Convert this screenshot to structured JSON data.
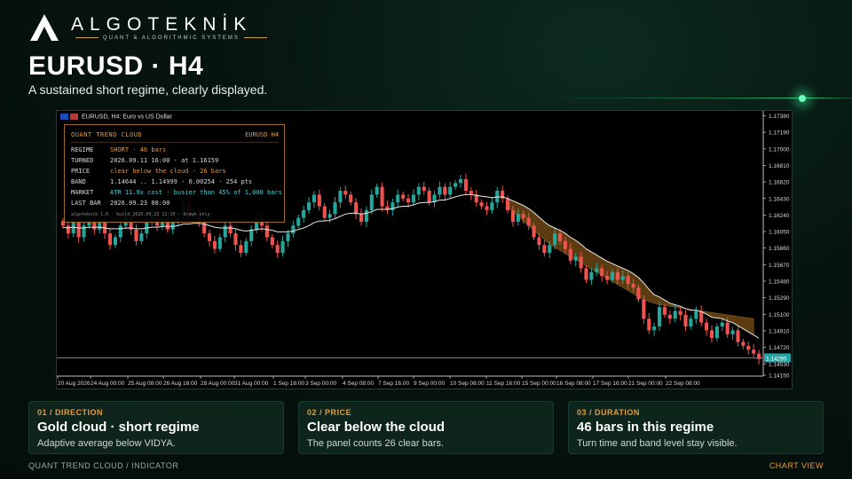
{
  "brand": {
    "name": "ALGOTEKNİK",
    "tagline": "QUANT & ALGORITHMIC SYSTEMS",
    "accent": "#caa24a"
  },
  "header": {
    "title": "EURUSD · H4",
    "subtitle": "A sustained short regime, clearly displayed."
  },
  "chart_window": {
    "title": "EURUSD, H4:  Euro vs US Dollar",
    "icons": [
      "flag-eu-icon",
      "flag-us-icon"
    ]
  },
  "panel": {
    "title": "QUANT TREND CLOUD",
    "symbol": "EURUSD H4",
    "rows": [
      {
        "key": "REGIME",
        "value": "SHORT  · 46 bars",
        "tone": "orange"
      },
      {
        "key": "TURNED",
        "value": "2026.09.11 16:00 · at 1.16159",
        "tone": "normal"
      },
      {
        "key": "PRICE",
        "value": "clear below the cloud · 26 bars",
        "tone": "orange"
      },
      {
        "key": "BAND",
        "value": "1.14644 .. 1.14999 · 0.00254 · 254 pts",
        "tone": "normal"
      },
      {
        "key": "MARKET",
        "value": "ATR 11.9x cost · busier than 45% of 1,000 bars",
        "tone": "cyan"
      },
      {
        "key": "LAST BAR",
        "value": "2026.09.23 08:00",
        "tone": "normal"
      }
    ],
    "footer": "algoteknik 1.0 · build 2026.09.22 12:10 · drawn only"
  },
  "chart_data": {
    "type": "candlestick",
    "symbol": "EURUSD",
    "timeframe": "H4",
    "ylim": [
      1.1406,
      1.1748
    ],
    "y_ticks": [
      "1.17380",
      "1.17190",
      "1.17000",
      "1.16810",
      "1.16620",
      "1.16430",
      "1.16240",
      "1.16050",
      "1.15860",
      "1.15670",
      "1.15480",
      "1.15290",
      "1.15100",
      "1.14910",
      "1.14720",
      "1.14530",
      "1.14150"
    ],
    "x_ticks": [
      "20 Aug 2026",
      "24 Aug 00:00",
      "25 Aug 08:00",
      "26 Aug 16:00",
      "28 Aug 00:00",
      "31 Aug 00:00",
      "1 Sep 16:00",
      "3 Sep 00:00",
      "4 Sep 08:00",
      "7 Sep 16:00",
      "9 Sep 00:00",
      "10 Sep 08:00",
      "11 Sep 16:00",
      "15 Sep 00:00",
      "16 Sep 08:00",
      "17 Sep 16:00",
      "21 Sep 00:00",
      "22 Sep 08:00"
    ],
    "current_price": "1.14295",
    "current_price_value": 1.14295,
    "colors": {
      "bull": "#26a69a",
      "bear": "#ef5350",
      "cloud": "#6b4512",
      "avg": "#e8e8e8",
      "price_line": "#1fa7a7"
    },
    "close": [
      1.16,
      1.159,
      1.161,
      1.1585,
      1.16,
      1.161,
      1.1595,
      1.1605,
      1.159,
      1.1575,
      1.1585,
      1.16,
      1.1615,
      1.1595,
      1.158,
      1.159,
      1.1605,
      1.162,
      1.16,
      1.161,
      1.1595,
      1.1605,
      1.1615,
      1.163,
      1.161,
      1.162,
      1.1605,
      1.159,
      1.158,
      1.157,
      1.1585,
      1.16,
      1.159,
      1.1575,
      1.1565,
      1.158,
      1.1595,
      1.161,
      1.16,
      1.1585,
      1.1575,
      1.1565,
      1.158,
      1.159,
      1.16,
      1.161,
      1.162,
      1.163,
      1.164,
      1.1625,
      1.161,
      1.1615,
      1.163,
      1.1645,
      1.164,
      1.163,
      1.1615,
      1.1605,
      1.162,
      1.164,
      1.165,
      1.1625,
      1.162,
      1.163,
      1.164,
      1.1635,
      1.163,
      1.164,
      1.165,
      1.1645,
      1.163,
      1.164,
      1.165,
      1.164,
      1.165,
      1.1655,
      1.166,
      1.1645,
      1.164,
      1.163,
      1.1625,
      1.162,
      1.163,
      1.1645,
      1.1635,
      1.162,
      1.1605,
      1.1615,
      1.161,
      1.16,
      1.1585,
      1.1575,
      1.1565,
      1.1575,
      1.159,
      1.158,
      1.157,
      1.1555,
      1.156,
      1.1545,
      1.153,
      1.154,
      1.1545,
      1.1535,
      1.153,
      1.154,
      1.153,
      1.1535,
      1.1525,
      1.152,
      1.1505,
      1.148,
      1.1465,
      1.147,
      1.1495,
      1.1485,
      1.148,
      1.149,
      1.1485,
      1.147,
      1.148,
      1.149,
      1.1475,
      1.1465,
      1.1455,
      1.147,
      1.1475,
      1.146,
      1.1465,
      1.145,
      1.1445,
      1.144,
      1.1435,
      1.1428
    ],
    "cloud_upper": [
      null,
      null,
      null,
      null,
      null,
      null,
      null,
      null,
      null,
      null,
      null,
      null,
      null,
      null,
      null,
      null,
      null,
      null,
      null,
      null,
      null,
      null,
      null,
      null,
      null,
      null,
      null,
      null,
      null,
      null,
      null,
      null,
      null,
      null,
      null,
      null,
      null,
      null,
      null,
      null,
      null,
      null,
      null,
      null,
      null,
      null,
      null,
      null,
      null,
      null,
      null,
      null,
      null,
      null,
      null,
      null,
      null,
      null,
      null,
      null,
      null,
      null,
      null,
      null,
      null,
      null,
      null,
      null,
      null,
      null,
      null,
      null,
      null,
      null,
      null,
      null,
      null,
      null,
      null,
      null,
      null,
      null,
      null,
      null,
      null,
      1.1624,
      1.1618,
      1.1612,
      1.1606,
      1.16,
      1.1594,
      1.1588,
      1.1582,
      1.1576,
      1.1572,
      1.1568,
      1.1564,
      1.156,
      1.1556,
      1.1552,
      1.1548,
      1.1544,
      1.154,
      1.1536,
      1.1532,
      1.1528,
      1.1524,
      1.152,
      1.1516,
      1.1512,
      1.1508,
      1.1505,
      1.1502,
      1.15,
      1.1498,
      1.1497,
      1.1496,
      1.1495,
      1.1494,
      1.1493,
      1.1492,
      1.1491,
      1.149,
      1.1489,
      1.1488,
      1.1487,
      1.1486,
      1.1485,
      1.1484,
      1.1483,
      1.1482,
      1.1481,
      1.148
    ],
    "average": [
      1.1598,
      1.1597,
      1.1598,
      1.1597,
      1.1597,
      1.1598,
      1.1598,
      1.1598,
      1.1597,
      1.1596,
      1.1596,
      1.1596,
      1.1597,
      1.1597,
      1.1596,
      1.1596,
      1.1597,
      1.1598,
      1.1598,
      1.1599,
      1.1599,
      1.1599,
      1.16,
      1.1602,
      1.1602,
      1.1603,
      1.1603,
      1.1602,
      1.16,
      1.1598,
      1.1597,
      1.1597,
      1.1597,
      1.1596,
      1.1594,
      1.1593,
      1.1594,
      1.1595,
      1.1596,
      1.1595,
      1.1594,
      1.1592,
      1.1592,
      1.1592,
      1.1593,
      1.1595,
      1.1597,
      1.16,
      1.1604,
      1.1606,
      1.1606,
      1.1607,
      1.1609,
      1.1612,
      1.1615,
      1.1616,
      1.1616,
      1.1615,
      1.1616,
      1.1618,
      1.1621,
      1.1621,
      1.1621,
      1.1622,
      1.1624,
      1.1625,
      1.1625,
      1.1627,
      1.1629,
      1.163,
      1.163,
      1.1631,
      1.1633,
      1.1633,
      1.1635,
      1.1637,
      1.1639,
      1.164,
      1.164,
      1.1639,
      1.1638,
      1.1637,
      1.1636,
      1.1637,
      1.1637,
      1.1635,
      1.1632,
      1.1629,
      1.1626,
      1.1622,
      1.1617,
      1.1611,
      1.1605,
      1.16,
      1.1597,
      1.1594,
      1.159,
      1.1585,
      1.1581,
      1.1576,
      1.157,
      1.1566,
      1.1562,
      1.1558,
      1.1554,
      1.1551,
      1.1548,
      1.1545,
      1.1542,
      1.1538,
      1.1533,
      1.1526,
      1.1518,
      1.1511,
      1.1508,
      1.1504,
      1.15,
      1.1498,
      1.1496,
      1.1493,
      1.1491,
      1.1491,
      1.1489,
      1.1486,
      1.1482,
      1.1481,
      1.148,
      1.1477,
      1.1475,
      1.1471,
      1.1467,
      1.1463,
      1.1459,
      1.1455
    ]
  },
  "cards": [
    {
      "kicker": "01 / DIRECTION",
      "title": "Gold cloud · short regime",
      "body": "Adaptive average below VIDYA."
    },
    {
      "kicker": "02 / PRICE",
      "title": "Clear below the cloud",
      "body": "The panel counts 26 clear bars."
    },
    {
      "kicker": "03 / DURATION",
      "title": "46 bars in this regime",
      "body": "Turn time and band level stay visible."
    }
  ],
  "footer": {
    "left": "QUANT TREND CLOUD / INDICATOR",
    "right": "CHART VIEW"
  }
}
